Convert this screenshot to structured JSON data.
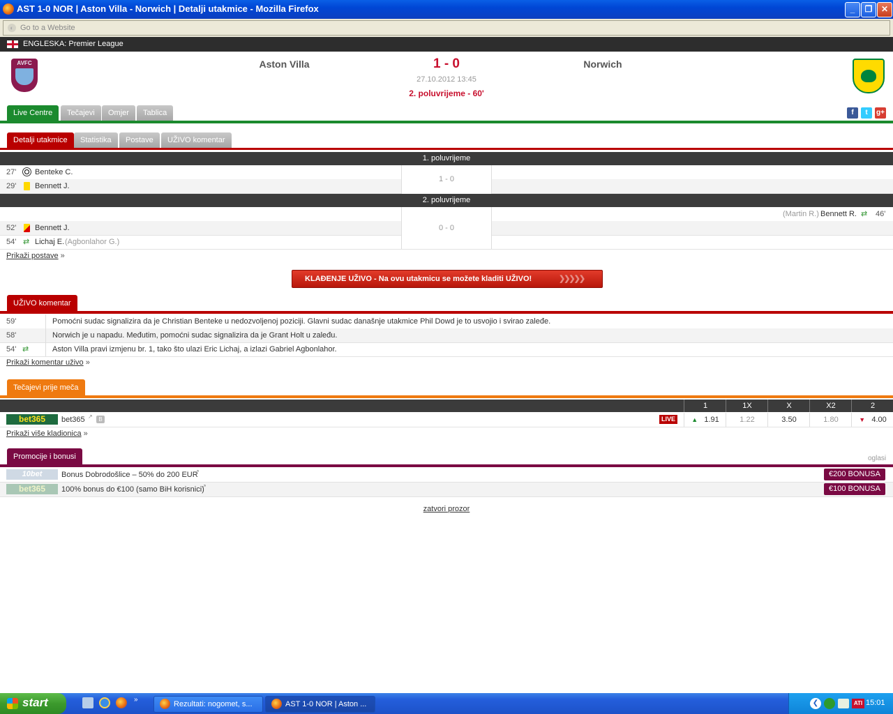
{
  "window": {
    "title": "AST 1-0 NOR | Aston Villa - Norwich | Detalji utakmice - Mozilla Firefox"
  },
  "address_bar": {
    "placeholder": "Go to a Website"
  },
  "league": {
    "label": "ENGLESKA: Premier League"
  },
  "match": {
    "home": "Aston Villa",
    "away": "Norwich",
    "score": "1 - 0",
    "datetime": "27.10.2012 13:45",
    "status": "2. poluvrijeme - 60'",
    "home_crest_text": "AVFC"
  },
  "main_tabs": [
    "Live Centre",
    "Tečajevi",
    "Omjer",
    "Tablica"
  ],
  "detail_tabs": [
    "Detalji utakmice",
    "Statistika",
    "Postave",
    "UŽIVO komentar"
  ],
  "first_half": {
    "title": "1. poluvrijeme",
    "score": "1 - 0",
    "events": [
      {
        "minute": "27'",
        "icon": "goal-icon",
        "player": "Benteke C."
      },
      {
        "minute": "29'",
        "icon": "yellow-card-icon",
        "player": "Bennett J."
      }
    ]
  },
  "second_half": {
    "title": "2. poluvrijeme",
    "score": "0 - 0",
    "away_event": {
      "minute": "46'",
      "player": "Bennett R.",
      "sub_out": "(Martin R.)"
    },
    "events": [
      {
        "minute": "52'",
        "icon": "second-yellow-card-icon",
        "player": "Bennett J.",
        "extra": ""
      },
      {
        "minute": "54'",
        "icon": "substitution-icon",
        "player": "Lichaj E.",
        "extra": "(Agbonlahor G.)"
      }
    ]
  },
  "show_lineups": "Prikaži postave",
  "bet_banner": "KLAĐENJE UŽIVO  -  Na ovu utakmicu se možete kladiti UŽIVO!",
  "commentary": {
    "tab": "UŽIVO komentar",
    "rows": [
      {
        "minute": "59'",
        "text": "Pomoćni sudac signalizira da je Christian Benteke u nedozvoljenoj poziciji. Glavni sudac današnje utakmice Phil Dowd je to usvojio i svirao zaleđe."
      },
      {
        "minute": "58'",
        "text": "Norwich je u napadu. Međutim, pomoćni sudac signalizira da je Grant Holt u zaleđu."
      },
      {
        "minute": "54'",
        "text": "Aston Villa pravi izmjenu br. 1, tako što ulazi Eric Lichaj, a izlazi Gabriel Agbonlahor."
      }
    ],
    "more": "Prikaži komentar uživo"
  },
  "odds": {
    "tab": "Tečajevi prije meča",
    "headers": [
      "1",
      "1X",
      "X",
      "X2",
      "2"
    ],
    "bookmaker_logo": "bet365",
    "bookmaker": "bet365",
    "badge": "B",
    "live": "LIVE",
    "values": [
      "1.91",
      "1.22",
      "3.50",
      "1.80",
      "4.00"
    ],
    "more": "Prikaži više kladionica"
  },
  "promos": {
    "tab": "Promocije i bonusi",
    "ads_label": "oglasi",
    "rows": [
      {
        "logo": "10bet",
        "text": "Bonus Dobrodošlice – 50% do 200 EUR",
        "button": "€200 BONUSA"
      },
      {
        "logo": "bet365",
        "text": "100% bonus do €100 (samo BiH korisnici)",
        "button": "€100 BONUSA"
      }
    ]
  },
  "close_window": "zatvori prozor",
  "taskbar": {
    "start": "start",
    "tasks": [
      "Rezultati: nogomet, s...",
      "AST 1-0 NOR | Aston ..."
    ],
    "clock": "15:01",
    "tray_label": "ATI"
  }
}
